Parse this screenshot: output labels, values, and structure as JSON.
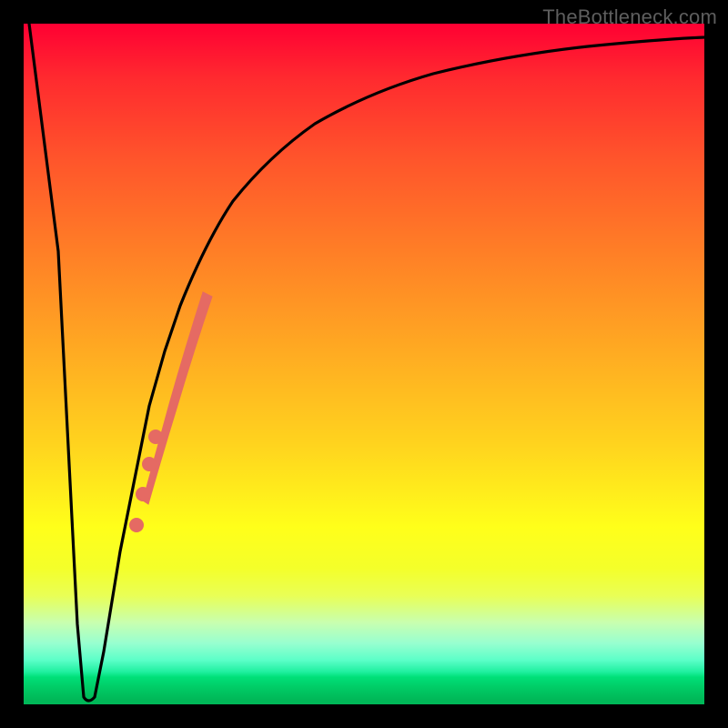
{
  "watermark": "TheBottleneck.com",
  "chart_data": {
    "type": "line",
    "title": "",
    "xlabel": "",
    "ylabel": "",
    "xlim": [
      0,
      100
    ],
    "ylim": [
      0,
      100
    ],
    "grid": false,
    "legend": false,
    "background_gradient": {
      "orientation": "vertical",
      "stops": [
        {
          "pos": 0.0,
          "color": "#ff0033"
        },
        {
          "pos": 0.5,
          "color": "#ffaa22"
        },
        {
          "pos": 0.8,
          "color": "#ffff1a"
        },
        {
          "pos": 0.96,
          "color": "#00e078"
        },
        {
          "pos": 1.0,
          "color": "#00b858"
        }
      ]
    },
    "series": [
      {
        "name": "bottleneck-curve",
        "color": "#000000",
        "x": [
          0,
          4,
          8,
          9,
          10,
          11,
          12,
          14,
          16,
          18,
          20,
          22,
          24,
          26,
          28,
          30,
          34,
          38,
          42,
          48,
          56,
          66,
          80,
          100
        ],
        "y": [
          100,
          67,
          12,
          1,
          0.5,
          1,
          8,
          22,
          34,
          44,
          52,
          58,
          63,
          67,
          71,
          74,
          79,
          82.5,
          85,
          88,
          91,
          93.3,
          95.3,
          97
        ]
      }
    ],
    "highlight_segment": {
      "color": "#e56a63",
      "x_range": [
        17,
        27
      ],
      "y_range": [
        23,
        69
      ],
      "width_profile": "tapered",
      "dots": [
        {
          "x": 16.3,
          "y": 28
        },
        {
          "x": 17.4,
          "y": 34
        },
        {
          "x": 18.3,
          "y": 38.5
        },
        {
          "x": 19.2,
          "y": 42.5
        }
      ]
    }
  }
}
